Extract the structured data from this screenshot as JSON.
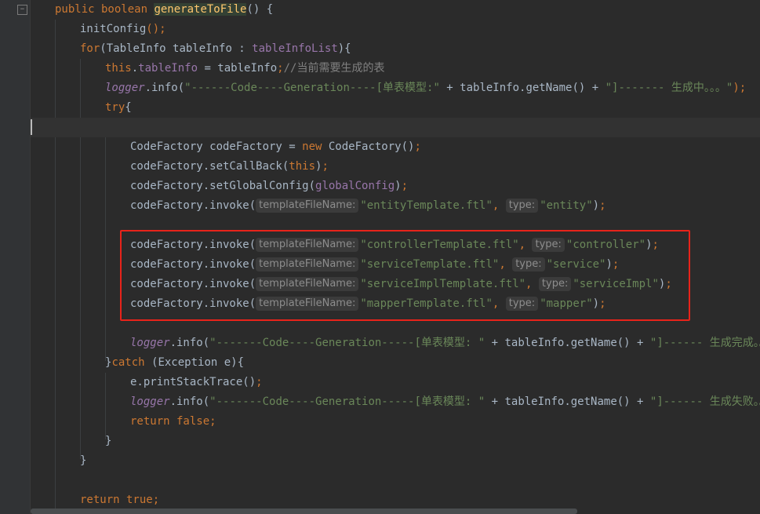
{
  "code": {
    "l1_kw": "public boolean ",
    "l1_method": "generateToFile",
    "l1_rest": "() {",
    "l2_call": "initConfig",
    "l2_paren": "()",
    "l2_semi": ";",
    "l3_for": "for",
    "l3_a": "(TableInfo tableInfo : ",
    "l3_list": "tableInfoList",
    "l3_b": "){",
    "l4_this": "this",
    "l4_dot": ".",
    "l4_field": "tableInfo",
    "l4_rest": " = tableInfo",
    "l4_semi": ";",
    "l4_comment": "//当前需要生成的表",
    "l5_logger": "logger",
    "l5_info": ".info(",
    "l5_str": "\"------Code----Generation----[单表模型:\"",
    "l5_mid": " + tableInfo.getName() + ",
    "l5_str2": "\"]------- 生成中。。。\"",
    "l5_end": ");",
    "l6_try": "try",
    "l6_brace": "{",
    "l8_a": "CodeFactory codeFactory = ",
    "l8_new": "new ",
    "l8_b": "CodeFactory()",
    "l8_semi": ";",
    "l9_a": "codeFactory.setCallBack(",
    "l9_this": "this",
    "l9_b": ")",
    "l9_semi": ";",
    "l10_a": "codeFactory.setGlobalConfig(",
    "l10_cfg": "globalConfig",
    "l10_b": ")",
    "l10_semi": ";",
    "invoke_prefix": "codeFactory.invoke(",
    "hint_file": "templateFileName:",
    "hint_type": "type:",
    "comma": ", ",
    "close": ")",
    "semi": ";",
    "invokes": [
      {
        "file": "\"entityTemplate.ftl\"",
        "type": "\"entity\""
      },
      {
        "file": "\"controllerTemplate.ftl\"",
        "type": "\"controller\""
      },
      {
        "file": "\"serviceTemplate.ftl\"",
        "type": "\"service\""
      },
      {
        "file": "\"serviceImplTemplate.ftl\"",
        "type": "\"serviceImpl\""
      },
      {
        "file": "\"mapperTemplate.ftl\"",
        "type": "\"mapper\""
      }
    ],
    "l17_logger": "logger",
    "l17_info": ".info(",
    "l17_str": "\"-------Code----Generation-----[单表模型: \"",
    "l17_mid": " + tableInfo.getName() + ",
    "l17_str2": "\"]------ 生成完成。。。\"",
    "l18_a": "}",
    "l18_catch": "catch ",
    "l18_b": "(Exception e){",
    "l19_a": "e.printStackTrace()",
    "l19_semi": ";",
    "l20_logger": "logger",
    "l20_info": ".info(",
    "l20_str": "\"-------Code----Generation-----[单表模型: \"",
    "l20_mid": " + tableInfo.getName() + ",
    "l20_str2": "\"]------ 生成失败。。。\"",
    "l21_return": "return false",
    "l21_semi": ";",
    "l22": "}",
    "l23": "}",
    "l25_return": "return true",
    "l25_semi": ";"
  },
  "colors": {
    "background": "#2b2b2b",
    "keyword": "#cc7832",
    "method": "#ffc66d",
    "field": "#9876aa",
    "string": "#6a8759",
    "comment": "#808080",
    "highlight_box": "#e8231a"
  },
  "icons": {
    "fold": "fold-minus-icon"
  }
}
